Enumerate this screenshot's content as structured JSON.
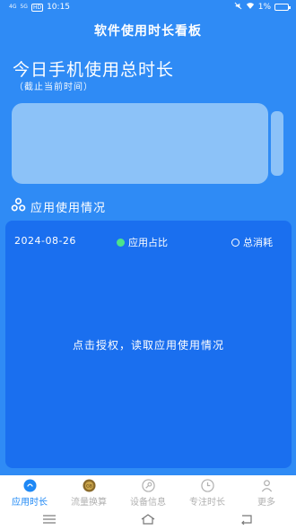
{
  "statusbar": {
    "signal1": "4G",
    "signal2": "5G",
    "hd": "HD",
    "time": "10:15",
    "battery_pct": "1%"
  },
  "header": {
    "title": "软件使用时长看板"
  },
  "summary": {
    "title": "今日手机使用总时长",
    "subtitle": "（截止当前时间）"
  },
  "section": {
    "title": "应用使用情况"
  },
  "card": {
    "date": "2024-08-26",
    "legend_app_share": "应用占比",
    "legend_total": "总消耗",
    "message": "点击授权，读取应用使用情况"
  },
  "tabs": [
    {
      "label": "应用时长",
      "active": true,
      "icon": "clock-bubble-icon"
    },
    {
      "label": "流量换算",
      "active": false,
      "icon": "data-coin-icon"
    },
    {
      "label": "设备信息",
      "active": false,
      "icon": "device-info-icon"
    },
    {
      "label": "专注时长",
      "active": false,
      "icon": "clock-icon"
    },
    {
      "label": "更多",
      "active": false,
      "icon": "person-icon"
    }
  ],
  "colors": {
    "background": "#2F8BF5",
    "card": "#1A6FEF",
    "battery": "#8CC2F8",
    "accent": "#1E88F5",
    "legend_green": "#4CE38A"
  }
}
